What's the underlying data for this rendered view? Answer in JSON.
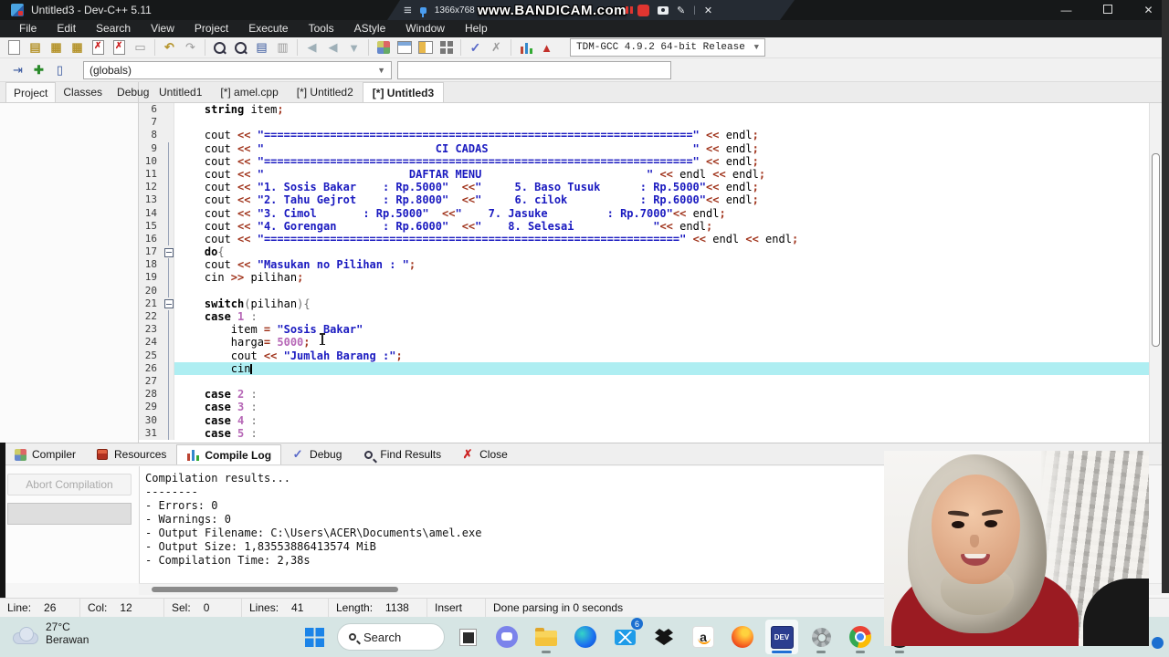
{
  "window": {
    "title": "Untitled3 - Dev-C++ 5.11"
  },
  "bandicam": {
    "resolution": "1366x768",
    "watermark": "www.BANDICAM.com"
  },
  "menu": {
    "items": [
      "File",
      "Edit",
      "Search",
      "View",
      "Project",
      "Execute",
      "Tools",
      "AStyle",
      "Window",
      "Help"
    ]
  },
  "toolbar": {
    "compiler_select": "TDM-GCC 4.9.2 64-bit Release",
    "globals_select": "(globals)",
    "combo2_value": ""
  },
  "left_tabs": [
    {
      "label": "Project",
      "active": true
    },
    {
      "label": "Classes",
      "active": false
    },
    {
      "label": "Debug",
      "active": false
    }
  ],
  "editor_tabs": [
    {
      "label": "Untitled1",
      "active": false
    },
    {
      "label": "[*] amel.cpp",
      "active": false
    },
    {
      "label": "[*] Untitled2",
      "active": false
    },
    {
      "label": "[*] Untitled3",
      "active": true
    }
  ],
  "editor": {
    "current_line": 26,
    "lines": [
      {
        "n": 6,
        "g": "",
        "t": [
          [
            "",
            "    "
          ],
          [
            "k",
            "string"
          ],
          [
            "",
            " item"
          ],
          [
            "o",
            ";"
          ]
        ]
      },
      {
        "n": 7,
        "g": "",
        "t": []
      },
      {
        "n": 8,
        "g": "",
        "t": [
          [
            "",
            "    cout "
          ],
          [
            "o",
            "<< "
          ],
          [
            "s",
            "\"=================================================================\""
          ],
          [
            "",
            " "
          ],
          [
            "o",
            "<<"
          ],
          [
            "",
            " endl"
          ],
          [
            "o",
            ";"
          ]
        ]
      },
      {
        "n": 9,
        "g": "l",
        "t": [
          [
            "",
            "    cout "
          ],
          [
            "o",
            "<< "
          ],
          [
            "s",
            "\"                          CI CADAS                               \""
          ],
          [
            "",
            " "
          ],
          [
            "o",
            "<<"
          ],
          [
            "",
            " endl"
          ],
          [
            "o",
            ";"
          ]
        ]
      },
      {
        "n": 10,
        "g": "l",
        "t": [
          [
            "",
            "    cout "
          ],
          [
            "o",
            "<< "
          ],
          [
            "s",
            "\"=================================================================\""
          ],
          [
            "",
            " "
          ],
          [
            "o",
            "<<"
          ],
          [
            "",
            " endl"
          ],
          [
            "o",
            ";"
          ]
        ]
      },
      {
        "n": 11,
        "g": "l",
        "t": [
          [
            "",
            "    cout "
          ],
          [
            "o",
            "<< "
          ],
          [
            "s",
            "\"                      DAFTAR MENU                         \""
          ],
          [
            "",
            " "
          ],
          [
            "o",
            "<<"
          ],
          [
            "",
            " endl "
          ],
          [
            "o",
            "<<"
          ],
          [
            "",
            " endl"
          ],
          [
            "o",
            ";"
          ]
        ]
      },
      {
        "n": 12,
        "g": "l",
        "t": [
          [
            "",
            "    cout "
          ],
          [
            "o",
            "<< "
          ],
          [
            "s",
            "\"1. Sosis Bakar    : Rp.5000\""
          ],
          [
            "",
            "  "
          ],
          [
            "o",
            "<<"
          ],
          [
            "s",
            "\"     5. Baso Tusuk      : Rp.5000\""
          ],
          [
            "o",
            "<<"
          ],
          [
            "",
            " endl"
          ],
          [
            "o",
            ";"
          ]
        ]
      },
      {
        "n": 13,
        "g": "l",
        "t": [
          [
            "",
            "    cout "
          ],
          [
            "o",
            "<< "
          ],
          [
            "s",
            "\"2. Tahu Gejrot    : Rp.8000\""
          ],
          [
            "",
            "  "
          ],
          [
            "o",
            "<<"
          ],
          [
            "s",
            "\"     6. cilok           : Rp.6000\""
          ],
          [
            "o",
            "<<"
          ],
          [
            "",
            " endl"
          ],
          [
            "o",
            ";"
          ]
        ]
      },
      {
        "n": 14,
        "g": "l",
        "t": [
          [
            "",
            "    cout "
          ],
          [
            "o",
            "<< "
          ],
          [
            "s",
            "\"3. Cimol       : Rp.5000\""
          ],
          [
            "",
            "  "
          ],
          [
            "o",
            "<<"
          ],
          [
            "s",
            "\"    7. Jasuke         : Rp.7000\""
          ],
          [
            "o",
            "<<"
          ],
          [
            "",
            " endl"
          ],
          [
            "o",
            ";"
          ]
        ]
      },
      {
        "n": 15,
        "g": "l",
        "t": [
          [
            "",
            "    cout "
          ],
          [
            "o",
            "<< "
          ],
          [
            "s",
            "\"4. Gorengan       : Rp.6000\""
          ],
          [
            "",
            "  "
          ],
          [
            "o",
            "<<"
          ],
          [
            "s",
            "\"    8. Selesai            \""
          ],
          [
            "o",
            "<<"
          ],
          [
            "",
            " endl"
          ],
          [
            "o",
            ";"
          ]
        ]
      },
      {
        "n": 16,
        "g": "l",
        "t": [
          [
            "",
            "    cout "
          ],
          [
            "o",
            "<< "
          ],
          [
            "s",
            "\"===============================================================\""
          ],
          [
            "",
            " "
          ],
          [
            "o",
            "<<"
          ],
          [
            "",
            " endl "
          ],
          [
            "o",
            "<<"
          ],
          [
            "",
            " endl"
          ],
          [
            "o",
            ";"
          ]
        ]
      },
      {
        "n": 17,
        "g": "b",
        "t": [
          [
            "",
            "    "
          ],
          [
            "k",
            "do"
          ],
          [
            "p",
            "{"
          ]
        ]
      },
      {
        "n": 18,
        "g": "l",
        "t": [
          [
            "",
            "    cout "
          ],
          [
            "o",
            "<< "
          ],
          [
            "s",
            "\"Masukan no Pilihan : \""
          ],
          [
            "o",
            ";"
          ]
        ]
      },
      {
        "n": 19,
        "g": "l",
        "t": [
          [
            "",
            "    cin "
          ],
          [
            "o",
            ">> "
          ],
          [
            "",
            "pilihan"
          ],
          [
            "o",
            ";"
          ]
        ]
      },
      {
        "n": 20,
        "g": "l",
        "t": []
      },
      {
        "n": 21,
        "g": "b",
        "t": [
          [
            "",
            "    "
          ],
          [
            "k",
            "switch"
          ],
          [
            "p",
            "("
          ],
          [
            "",
            "pilihan"
          ],
          [
            "p",
            ")"
          ],
          [
            "p",
            "{"
          ]
        ]
      },
      {
        "n": 22,
        "g": "l",
        "t": [
          [
            "",
            "    "
          ],
          [
            "k",
            "case"
          ],
          [
            "",
            " "
          ],
          [
            "n",
            "1"
          ],
          [
            "",
            " "
          ],
          [
            "p",
            ":"
          ]
        ]
      },
      {
        "n": 23,
        "g": "l",
        "t": [
          [
            "",
            "        item "
          ],
          [
            "o",
            "= "
          ],
          [
            "s",
            "\"Sosis Bakar\""
          ]
        ]
      },
      {
        "n": 24,
        "g": "l",
        "t": [
          [
            "",
            "        harga"
          ],
          [
            "o",
            "= "
          ],
          [
            "n",
            "5000"
          ],
          [
            "o",
            ";"
          ]
        ]
      },
      {
        "n": 25,
        "g": "l",
        "t": [
          [
            "",
            "        cout "
          ],
          [
            "o",
            "<< "
          ],
          [
            "s",
            "\"Jumlah Barang :\""
          ],
          [
            "o",
            ";"
          ]
        ]
      },
      {
        "n": 26,
        "g": "l",
        "t": [
          [
            "",
            "        cin"
          ]
        ]
      },
      {
        "n": 27,
        "g": "l",
        "t": []
      },
      {
        "n": 28,
        "g": "l",
        "t": [
          [
            "",
            "    "
          ],
          [
            "k",
            "case"
          ],
          [
            "",
            " "
          ],
          [
            "n",
            "2"
          ],
          [
            "",
            " "
          ],
          [
            "p",
            ":"
          ]
        ]
      },
      {
        "n": 29,
        "g": "l",
        "t": [
          [
            "",
            "    "
          ],
          [
            "k",
            "case"
          ],
          [
            "",
            " "
          ],
          [
            "n",
            "3"
          ],
          [
            "",
            " "
          ],
          [
            "p",
            ":"
          ]
        ]
      },
      {
        "n": 30,
        "g": "l",
        "t": [
          [
            "",
            "    "
          ],
          [
            "k",
            "case"
          ],
          [
            "",
            " "
          ],
          [
            "n",
            "4"
          ],
          [
            "",
            " "
          ],
          [
            "p",
            ":"
          ]
        ]
      },
      {
        "n": 31,
        "g": "l",
        "t": [
          [
            "",
            "    "
          ],
          [
            "k",
            "case"
          ],
          [
            "",
            " "
          ],
          [
            "n",
            "5"
          ],
          [
            "",
            " "
          ],
          [
            "p",
            ":"
          ]
        ]
      }
    ]
  },
  "bottom_panel": {
    "tabs": [
      {
        "label": "Compiler",
        "icon": "compiler",
        "active": false
      },
      {
        "label": "Resources",
        "icon": "resources",
        "active": false
      },
      {
        "label": "Compile Log",
        "icon": "log",
        "active": true
      },
      {
        "label": "Debug",
        "icon": "debug",
        "active": false
      },
      {
        "label": "Find Results",
        "icon": "find",
        "active": false
      },
      {
        "label": "Close",
        "icon": "close",
        "active": false
      }
    ],
    "abort_button": "Abort Compilation",
    "log_lines": [
      "Compilation results...",
      "--------",
      "- Errors: 0",
      "- Warnings: 0",
      "- Output Filename: C:\\Users\\ACER\\Documents\\amel.exe",
      "- Output Size: 1,83553886413574 MiB",
      "- Compilation Time: 2,38s"
    ]
  },
  "status_bar": {
    "segments": [
      {
        "label": "Line:",
        "value": "26",
        "w": 88
      },
      {
        "label": "Col:",
        "value": "12",
        "w": 92
      },
      {
        "label": "Sel:",
        "value": "0",
        "w": 85
      },
      {
        "label": "Lines:",
        "value": "41",
        "w": 95
      },
      {
        "label": "Length:",
        "value": "1138",
        "w": 108
      },
      {
        "label": "Insert",
        "value": "",
        "w": 64
      },
      {
        "label": "Done parsing in 0 seconds",
        "value": "",
        "w": 0
      }
    ]
  },
  "taskbar": {
    "weather_temp": "27°C",
    "weather_desc": "Berawan",
    "search_label": "Search",
    "mail_badge": "6",
    "dev_label": "DEV",
    "amazon_letter": "a"
  }
}
